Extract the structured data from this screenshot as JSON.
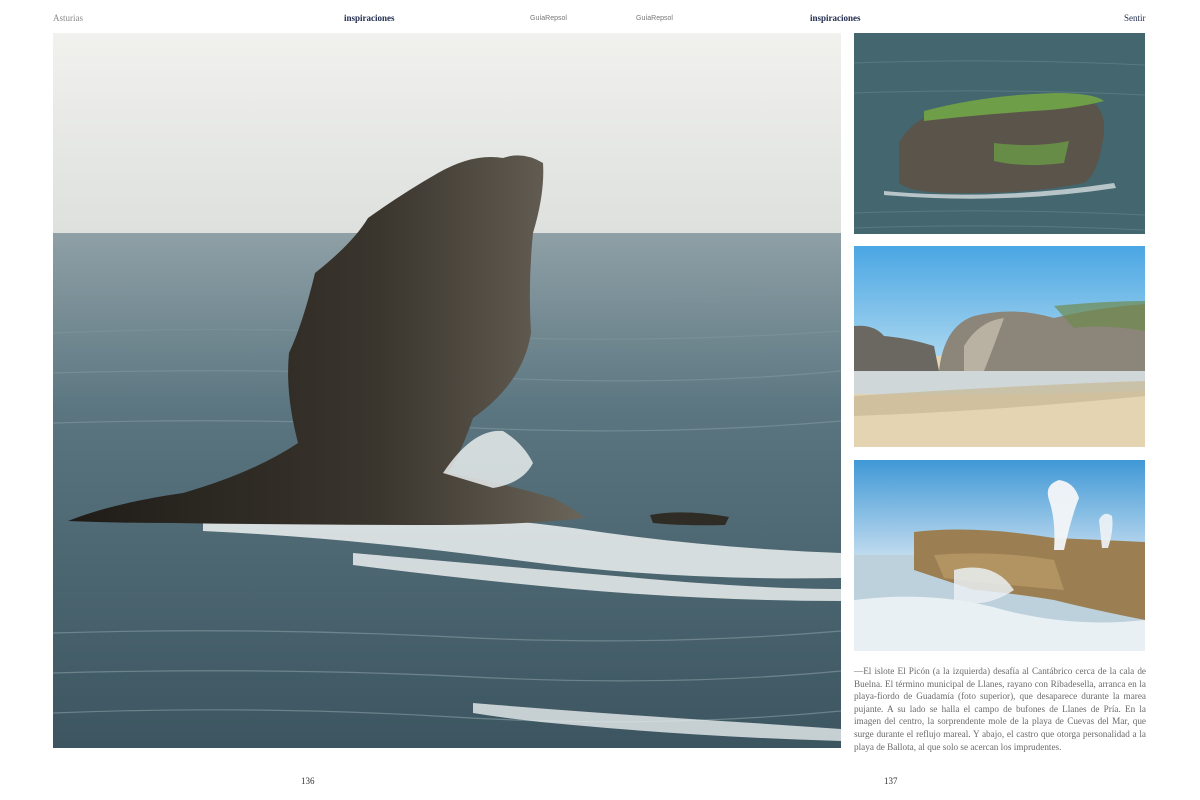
{
  "header": {
    "left_region": "Asturias",
    "left_section": "inspiraciones",
    "left_brand": "GuíaRepsol",
    "right_brand": "GuíaRepsol",
    "right_section": "inspiraciones",
    "right_category": "Sentir"
  },
  "photos": {
    "main": "photo-islote-el-picon",
    "top_right": "photo-playa-de-guadamia",
    "middle_right": "photo-playa-de-cuevas-del-mar",
    "bottom_right": "photo-bufones-de-pria"
  },
  "caption": "—El islote El Picón (a la izquierda) desafía al Cantábrico cerca de la cala de Buelna. El término municipal de Llanes, rayano con Ribadesella, arranca en la playa-fiordo de Guadamía (foto superior), que desaparece durante la marea pujante. A su lado se halla el campo de bufones de Llanes de Pría. En la imagen del centro, la sorprendente mole de la playa de Cuevas del Mar, que surge durante el reflujo mareal. Y abajo, el castro que otorga personalidad a la playa de Ballota, al que solo se acercan los imprudentes.",
  "page_numbers": {
    "left": "136",
    "right": "137"
  },
  "colors": {
    "section_heading": "#1f2a4d",
    "sea": "#4f6b76",
    "rock": "#2e2a24",
    "sand": "#e2d2b4",
    "sky": "#6ab6e6"
  }
}
